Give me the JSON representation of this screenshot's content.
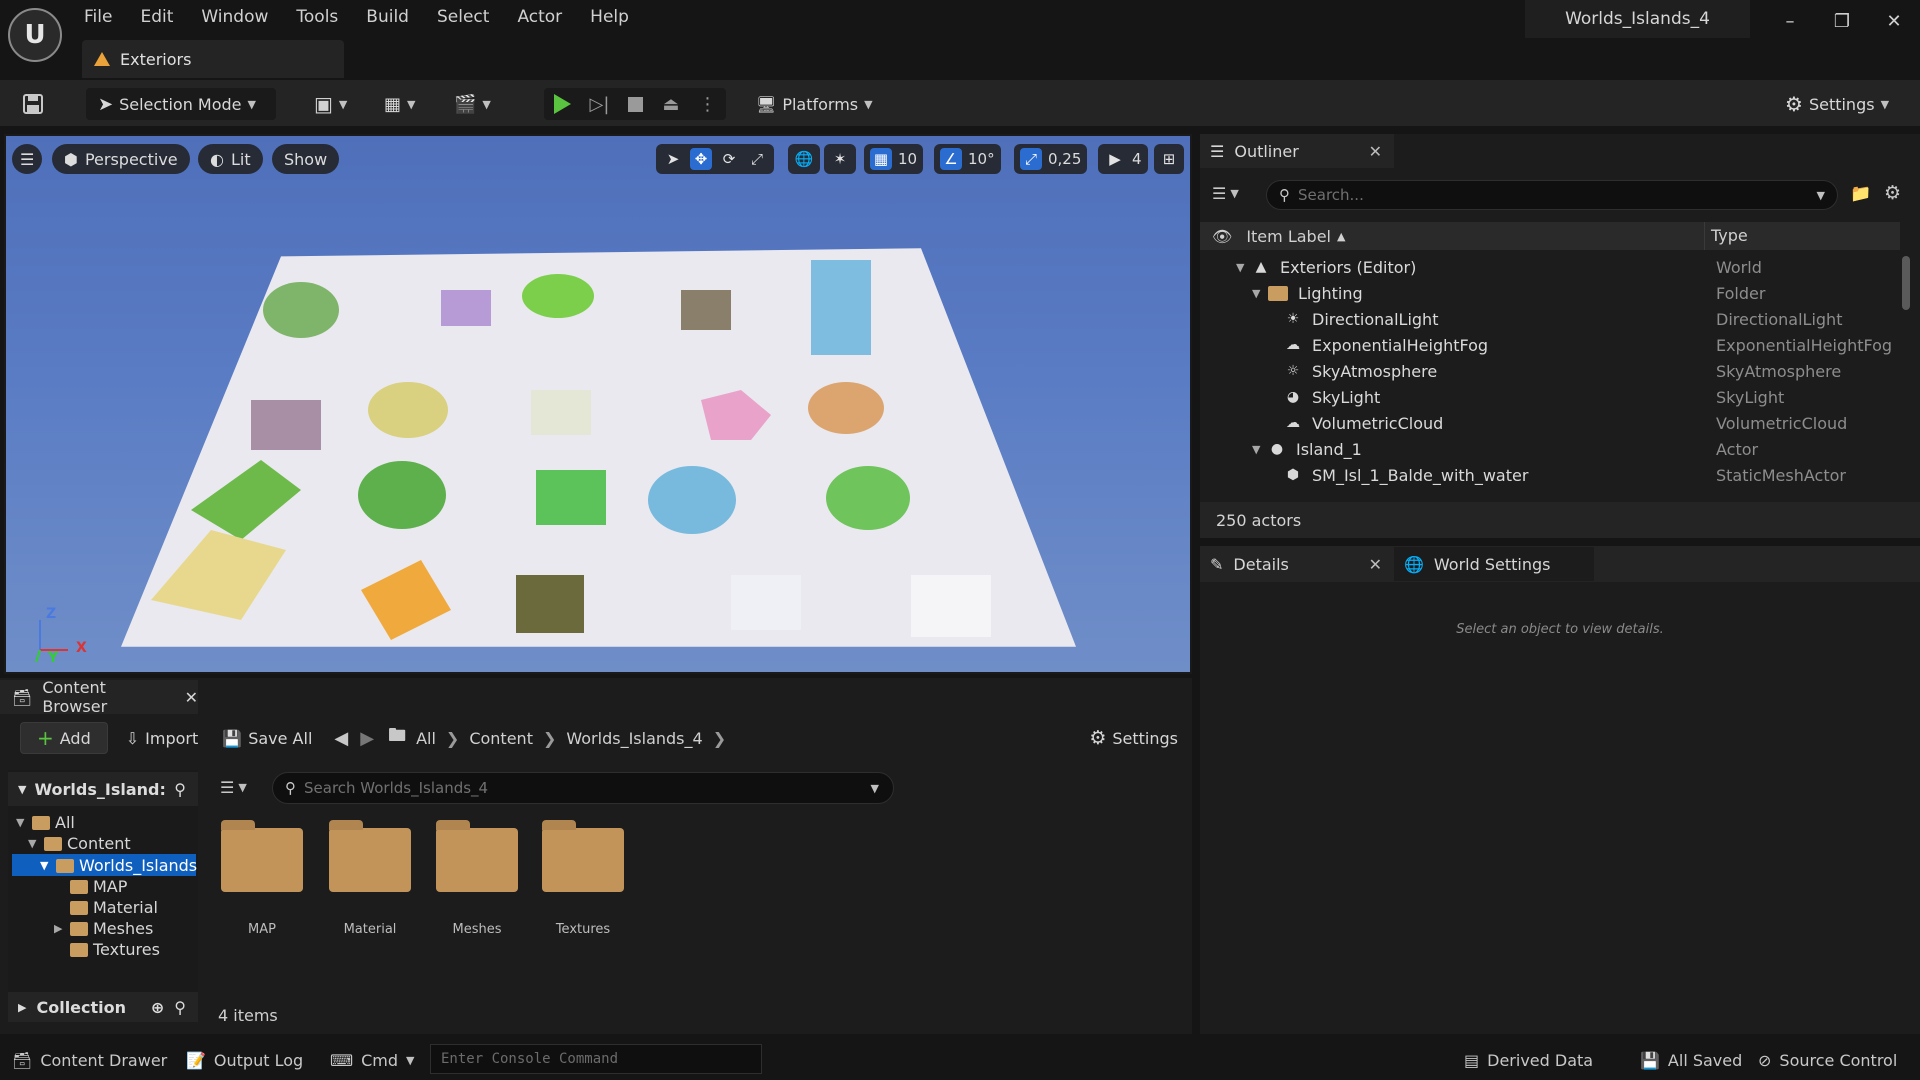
{
  "app": {
    "logo_text": "U",
    "window_title": "Worlds_Islands_4",
    "level_tab": "Exteriors",
    "menus": [
      "File",
      "Edit",
      "Window",
      "Tools",
      "Build",
      "Select",
      "Actor",
      "Help"
    ]
  },
  "toolbar": {
    "selection_mode": "Selection Mode",
    "platforms": "Platforms",
    "settings": "Settings"
  },
  "viewport": {
    "view_mode": "Perspective",
    "lighting": "Lit",
    "show": "Show",
    "grid_snap": "10",
    "rotation_snap": "10°",
    "scale_snap": "0,25",
    "camera_speed": "4",
    "axis_x": "X",
    "axis_y": "Y",
    "axis_z": "Z"
  },
  "outliner": {
    "title": "Outliner",
    "search_placeholder": "Search...",
    "col_label": "Item Label",
    "col_type": "Type",
    "rows": [
      {
        "label": "Exteriors (Editor)",
        "type": "World"
      },
      {
        "label": "Lighting",
        "type": "Folder"
      },
      {
        "label": "DirectionalLight",
        "type": "DirectionalLight"
      },
      {
        "label": "ExponentialHeightFog",
        "type": "ExponentialHeightFog"
      },
      {
        "label": "SkyAtmosphere",
        "type": "SkyAtmosphere"
      },
      {
        "label": "SkyLight",
        "type": "SkyLight"
      },
      {
        "label": "VolumetricCloud",
        "type": "VolumetricCloud"
      },
      {
        "label": "Island_1",
        "type": "Actor"
      },
      {
        "label": "SM_Isl_1_Balde_with_water",
        "type": "StaticMeshActor"
      }
    ],
    "actor_count": "250 actors"
  },
  "details": {
    "tab_details": "Details",
    "tab_world_settings": "World Settings",
    "empty_message": "Select an object to view details."
  },
  "content_browser": {
    "title": "Content Browser",
    "add": "Add",
    "import": "Import",
    "save_all": "Save All",
    "settings": "Settings",
    "breadcrumb": [
      "All",
      "Content",
      "Worlds_Islands_4"
    ],
    "tree_root": "Worlds_Island:",
    "tree": {
      "all": "All",
      "content": "Content",
      "worlds": "Worlds_Islands",
      "map": "MAP",
      "material": "Material",
      "meshes": "Meshes",
      "textures": "Textures"
    },
    "search_placeholder": "Search Worlds_Islands_4",
    "assets": [
      "MAP",
      "Material",
      "Meshes",
      "Textures"
    ],
    "item_count": "4 items",
    "collection": "Collection"
  },
  "statusbar": {
    "content_drawer": "Content Drawer",
    "output_log": "Output Log",
    "cmd": "Cmd",
    "console_placeholder": "Enter Console Command",
    "derived_data": "Derived Data",
    "all_saved": "All Saved",
    "source_control": "Source Control"
  }
}
